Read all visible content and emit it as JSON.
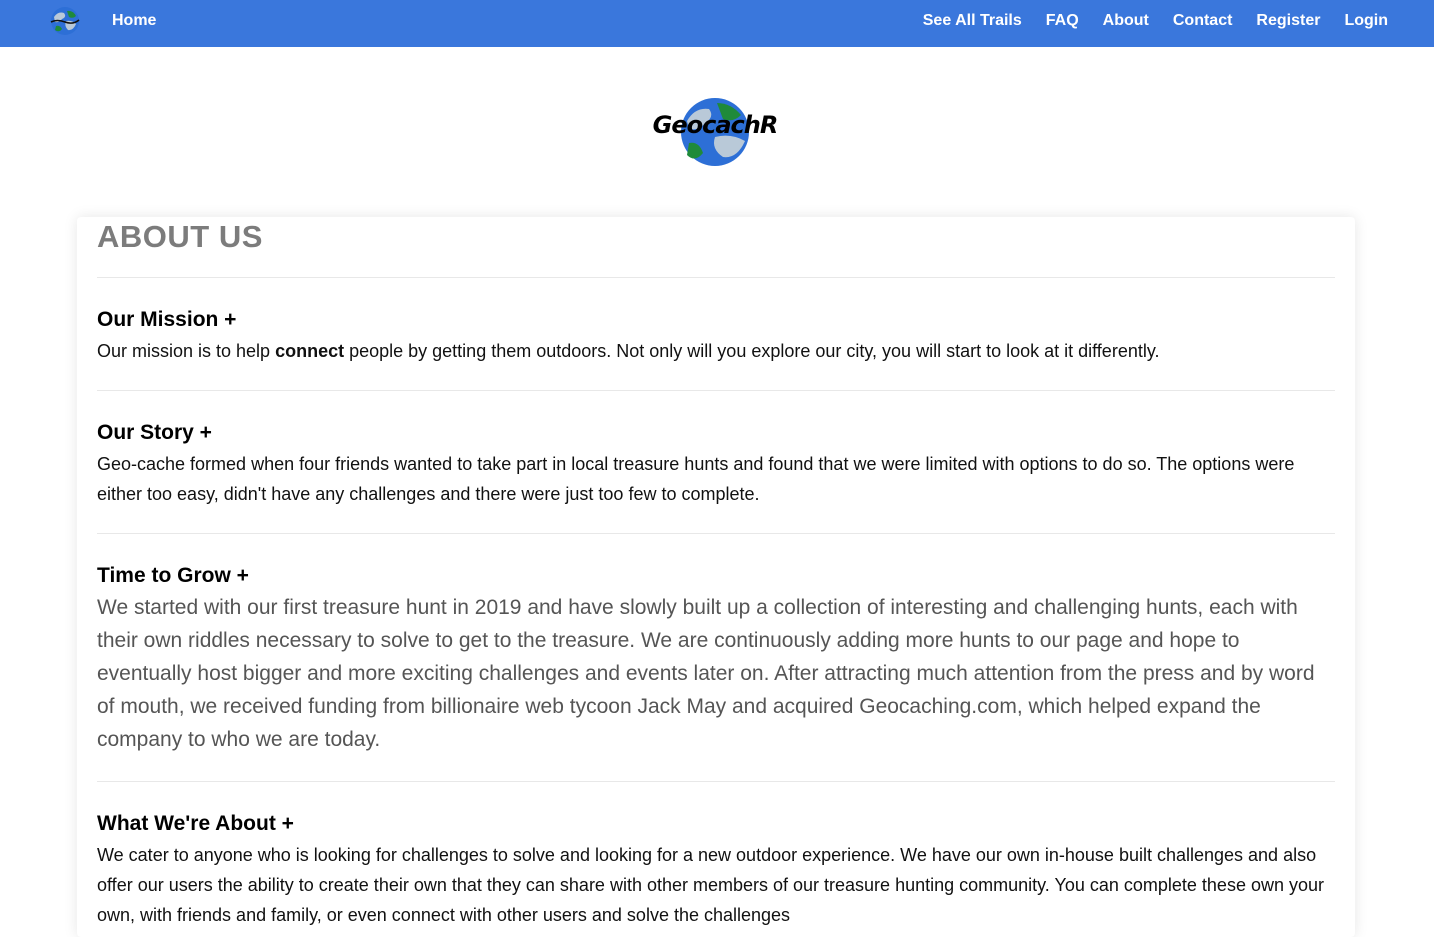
{
  "nav": {
    "home": "Home",
    "links": [
      "See All Trails",
      "FAQ",
      "About",
      "Contact",
      "Register",
      "Login"
    ],
    "bg_color": "#3a77dc"
  },
  "brand": {
    "name": "GeocachR",
    "logo_icon": "globe-icon"
  },
  "page": {
    "title": "ABOUT US"
  },
  "sections": [
    {
      "heading": "Our Mission +",
      "body_pre": "Our mission is to help ",
      "body_bold": "connect",
      "body_post": " people by getting them outdoors. Not only will you explore our city, you will start to look at it differently."
    },
    {
      "heading": "Our Story +",
      "body": "Geo-cache formed when four friends wanted to take part in local treasure hunts and found that we were limited with options to do so. The options were either too easy, didn't have any challenges and there were just too few to complete."
    },
    {
      "heading": "Time to Grow +",
      "body": "We started with our first treasure hunt in 2019 and have slowly built up a collection of interesting and challenging hunts, each with their own riddles necessary to solve to get to the treasure. We are continuously adding more hunts to our page and hope to eventually host bigger and more exciting challenges and events later on. After attracting much attention from the press and by word of mouth, we received funding from billionaire web tycoon Jack May and acquired Geocaching.com, which helped expand the company to who we are today."
    },
    {
      "heading": "What We're About +",
      "body": "We cater to anyone who is looking for challenges to solve and looking for a new outdoor experience. We have our own in-house built challenges and also offer our users the ability to create their own that they can share with other members of our treasure hunting community. You can complete these own your own, with friends and family, or even connect with other users and solve the challenges"
    }
  ]
}
